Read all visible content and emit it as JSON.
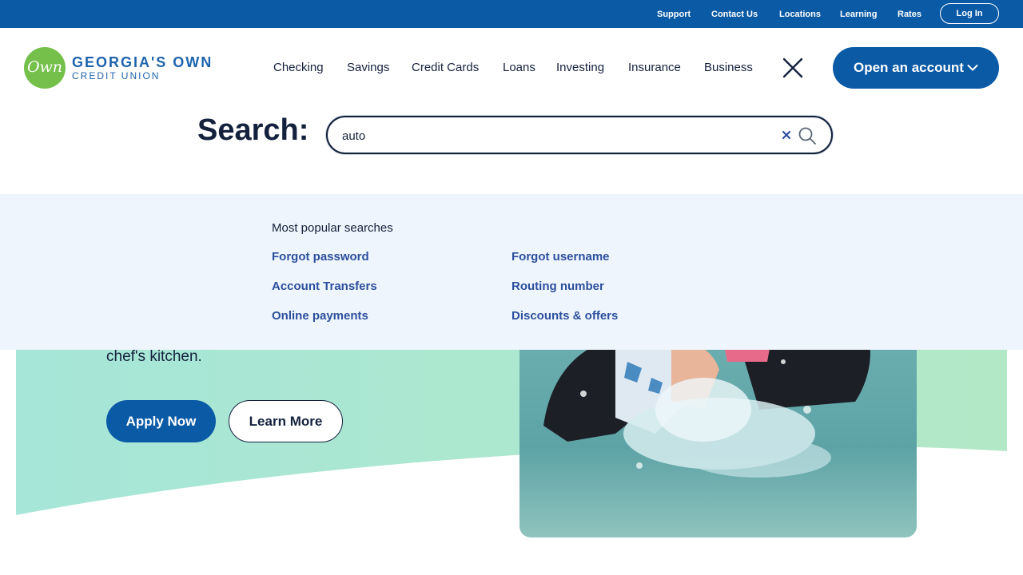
{
  "utility_nav": {
    "links": [
      "Support",
      "Contact Us",
      "Locations",
      "Learning",
      "Rates"
    ],
    "login_label": "Log In"
  },
  "brand": {
    "mark_text": "Own",
    "name": "GEORGIA'S OWN",
    "subtitle": "CREDIT UNION",
    "colors": {
      "primary": "#0a5aa6",
      "mark_green": "#74c04b",
      "navy": "#14213d",
      "link": "#2c4f9e"
    }
  },
  "main_nav": {
    "items": [
      "Checking",
      "Savings",
      "Credit Cards",
      "Loans",
      "Investing",
      "Insurance",
      "Business"
    ],
    "close_icon": "close-x-icon",
    "cta_label": "Open an account",
    "cta_icon": "chevron-down-icon"
  },
  "search": {
    "label": "Search:",
    "value": "auto",
    "clear_icon": "clear-x-icon",
    "search_icon": "magnifier-icon"
  },
  "popular": {
    "heading": "Most popular searches",
    "links": [
      "Forgot password",
      "Forgot username",
      "Account Transfers",
      "Routing number",
      "Online payments",
      "Discounts & offers"
    ]
  },
  "hero": {
    "text": "chef's kitchen.",
    "apply_label": "Apply Now",
    "learn_label": "Learn More",
    "photo_alt": "family-splashing-in-water"
  }
}
